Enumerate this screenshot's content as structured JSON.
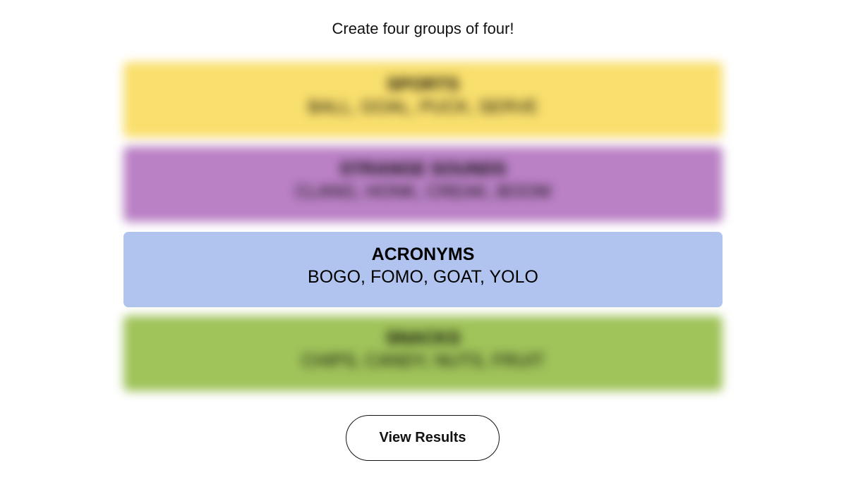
{
  "instructions": "Create four groups of four!",
  "groups": [
    {
      "category": "SPORTS",
      "words": "BALL, GOAL, PUCK, SERVE",
      "color": "#f9df6d",
      "revealed": false
    },
    {
      "category": "STRANGE SOUNDS",
      "words": "CLANG, HONK, CREAK, BOOM",
      "color": "#ba81c5",
      "revealed": false
    },
    {
      "category": "ACRONYMS",
      "words": "BOGO, FOMO, GOAT, YOLO",
      "color": "#b0c4ef",
      "revealed": true
    },
    {
      "category": "SNACKS",
      "words": "CHIPS, CANDY, NUTS, FRUIT",
      "color": "#a0c35a",
      "revealed": false
    }
  ],
  "view_results_label": "View Results"
}
